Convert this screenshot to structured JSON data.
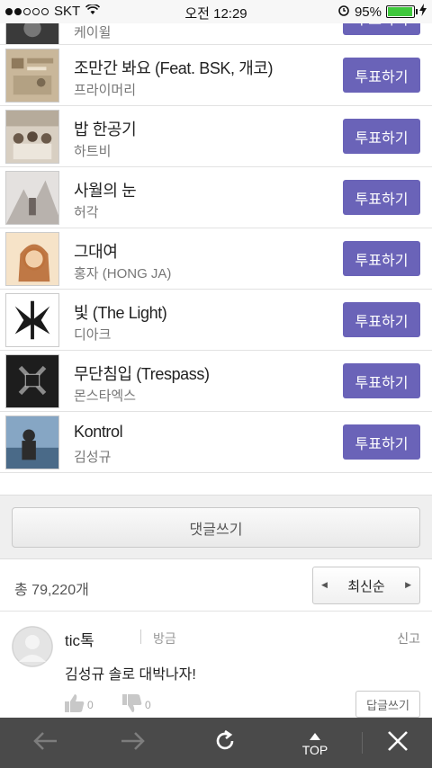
{
  "status_bar": {
    "carrier": "SKT",
    "time": "오전 12:29",
    "battery": "95%",
    "battery_level": 0.95,
    "signal_bars": 2
  },
  "songs": [
    {
      "title": "",
      "artist": "케이윌",
      "vote_label": "투표하기",
      "cover_color": "#3a3a3a"
    },
    {
      "title": "조만간 봐요 (Feat. BSK, 개코)",
      "artist": "프라이머리",
      "vote_label": "투표하기",
      "cover_color": "#c9b79a"
    },
    {
      "title": "밥 한공기",
      "artist": "하트비",
      "vote_label": "투표하기",
      "cover_color": "#bfb6a8"
    },
    {
      "title": "사월의 눈",
      "artist": "허각",
      "vote_label": "투표하기",
      "cover_color": "#d9d6d4"
    },
    {
      "title": "그대여",
      "artist": "홍자 (HONG JA)",
      "vote_label": "투표하기",
      "cover_color": "#f2d6b0"
    },
    {
      "title": "빛 (The Light)",
      "artist": "디아크",
      "vote_label": "투표하기",
      "cover_color": "#ffffff"
    },
    {
      "title": "무단침입 (Trespass)",
      "artist": "몬스타엑스",
      "vote_label": "투표하기",
      "cover_color": "#1d1d1d"
    },
    {
      "title": "Kontrol",
      "artist": "김성규",
      "vote_label": "투표하기",
      "cover_color": "#6b8db0"
    }
  ],
  "comments_section": {
    "write_label": "댓글쓰기",
    "total_count": "총 79,220개",
    "sort_label": "최신순"
  },
  "comment": {
    "author": "tic톡",
    "time": "방금",
    "report_label": "신고",
    "text": "김성규 솔로 대박나자!",
    "likes": "0",
    "dislikes": "0",
    "reply_label": "답글쓰기"
  },
  "toolbar": {
    "top_label": "TOP"
  },
  "colors": {
    "accent": "#6a63b8",
    "toolbar": "#4a4a4a",
    "battery": "#3ec83c"
  },
  "icons": [
    "wifi-icon",
    "alarm-icon",
    "charging-icon",
    "back-arrow-icon",
    "forward-arrow-icon",
    "reload-icon",
    "top-arrow-icon",
    "close-icon",
    "thumbs-up-icon",
    "thumbs-down-icon"
  ]
}
